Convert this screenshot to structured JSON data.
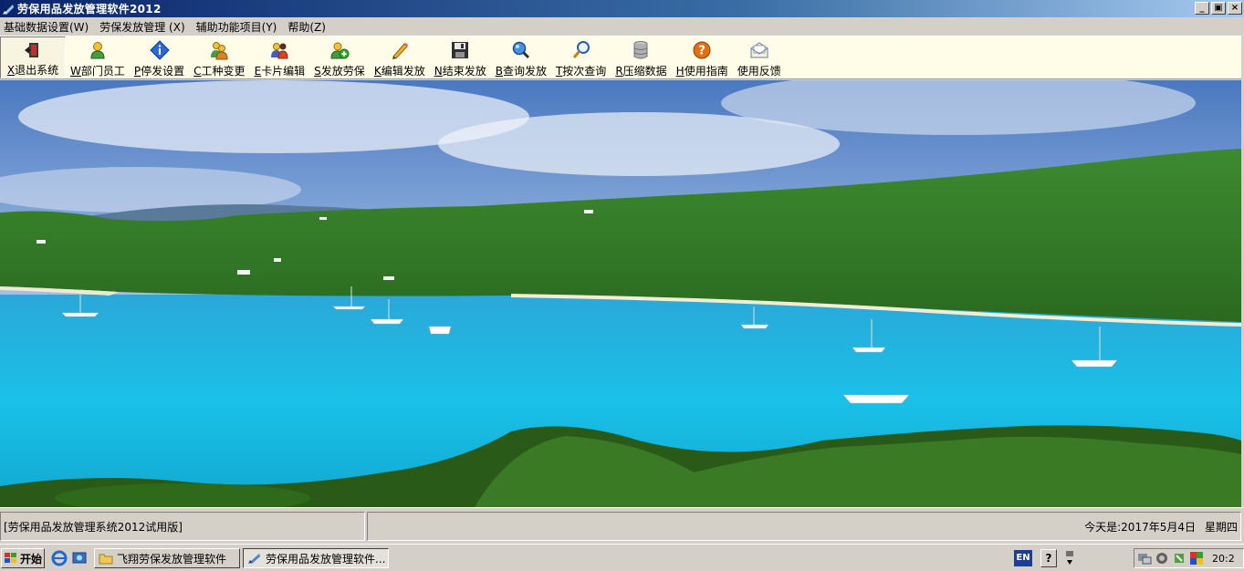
{
  "window": {
    "title": "劳保用品发放管理软件2012",
    "controls": [
      "_",
      "▣",
      "×"
    ]
  },
  "menu": [
    "基础数据设置(W)",
    "劳保发放管理 (X)",
    "辅助功能项目(Y)",
    "帮助(Z)"
  ],
  "toolbar": [
    {
      "key": "X",
      "label": "退出系统",
      "icon": "exit-door-icon"
    },
    {
      "key": "W",
      "label": "部门员工",
      "icon": "user-icon"
    },
    {
      "key": "P",
      "label": "停发设置",
      "icon": "info-diamond-icon"
    },
    {
      "key": "C",
      "label": "工种变更",
      "icon": "users-icon"
    },
    {
      "key": "E",
      "label": "卡片编辑",
      "icon": "user-card-icon"
    },
    {
      "key": "S",
      "label": "发放劳保",
      "icon": "user-add-icon"
    },
    {
      "key": "K",
      "label": "编辑发放",
      "icon": "pencil-icon"
    },
    {
      "key": "N",
      "label": "结束发放",
      "icon": "floppy-disk-icon"
    },
    {
      "key": "B",
      "label": "查询发放",
      "icon": "magnifier-blue-icon"
    },
    {
      "key": "T",
      "label": "按次查询",
      "icon": "magnifier-icon"
    },
    {
      "key": "R",
      "label": "压缩数据",
      "icon": "database-icon"
    },
    {
      "key": "H",
      "label": "使用指南",
      "icon": "help-icon"
    },
    {
      "key": "",
      "label": "使用反馈",
      "icon": "envelope-icon"
    }
  ],
  "statusbar": {
    "left": "[劳保用品发放管理系统2012试用版]",
    "today_label": "今天是:2017年5月4日",
    "weekday": "星期四"
  },
  "taskbar": {
    "start": "开始",
    "tasks": [
      {
        "label": "飞翔劳保发放管理软件",
        "active": false
      },
      {
        "label": "劳保用品发放管理软件...",
        "active": true
      }
    ],
    "lang": "EN",
    "help": "?",
    "clock": "20:2"
  },
  "colors": {
    "titlebar_start": "#0a246a",
    "toolbar_bg": "#fffde8",
    "chrome": "#d4d0c8"
  }
}
